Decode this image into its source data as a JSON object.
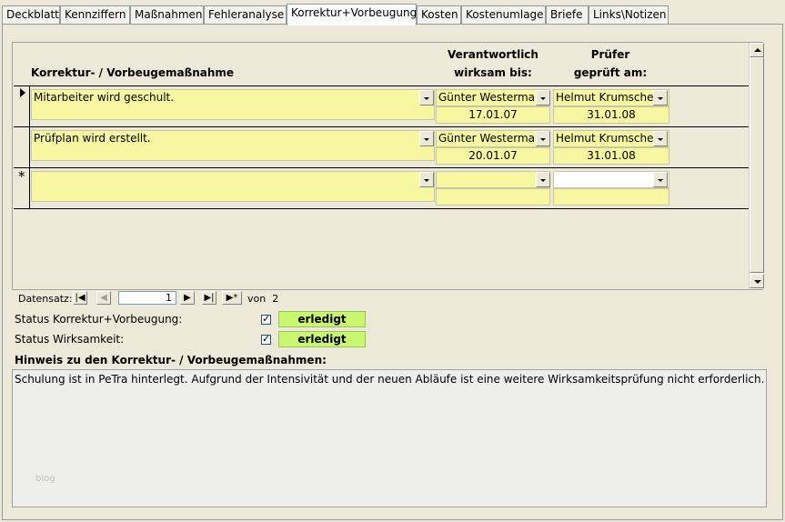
{
  "tabs": [
    "Deckblatt",
    "Kennziffern",
    "Maßnahmen",
    "Fehleranalyse",
    "Korrektur+Vorbeugung",
    "Kosten",
    "Kostenumlage",
    "Briefe",
    "Links\\Notizen"
  ],
  "headers": {
    "massnahme": "Korrektur- / Vorbeugemaßnahme",
    "verantwortlich": "Verantwortlich",
    "wirksam": "wirksam bis:",
    "pruefer": "Prüfer",
    "geprueft": "geprüft am:"
  },
  "rows": [
    {
      "massnahme": "Mitarbeiter wird geschult.",
      "verantwortlich": "Günter Westerman",
      "wirksam": "17.01.07",
      "pruefer": "Helmut Krumscheid",
      "geprueft": "31.01.08"
    },
    {
      "massnahme": "Prüfplan wird erstellt.",
      "verantwortlich": "Günter Westerman",
      "wirksam": "20.01.07",
      "pruefer": "Helmut Krumscheid",
      "geprueft": "31.01.08"
    }
  ],
  "new_row_marker": "*",
  "navigator": {
    "label": "Datensatz:",
    "current": "1",
    "of_label": "von",
    "total": "2"
  },
  "status": {
    "korrektur_label": "Status Korrektur+Vorbeugung:",
    "korrektur_checked": true,
    "korrektur_value": "erledigt",
    "wirksamkeit_label": "Status Wirksamkeit:",
    "wirksamkeit_checked": true,
    "wirksamkeit_value": "erledigt"
  },
  "hinweis": {
    "label": "Hinweis zu den Korrektur- / Vorbeugemaßnahmen:",
    "text": "Schulung ist in PeTra hinterlegt. Aufgrund der Intensivität und der neuen Abläufe ist eine weitere Wirksamkeitsprüfung nicht erforderlich.",
    "watermark": "blog"
  },
  "colors": {
    "field": "#f7f7a2",
    "status": "#c9f76f",
    "background": "#ece9d8"
  }
}
